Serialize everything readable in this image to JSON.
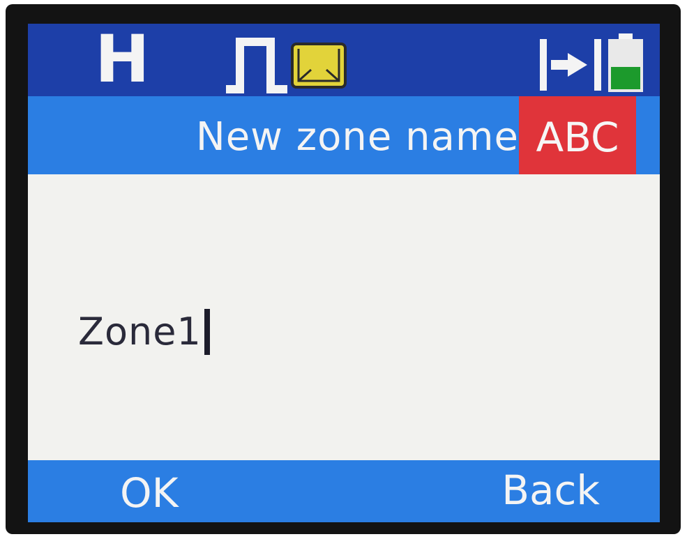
{
  "status_bar": {
    "channel_mode_label": "H",
    "icons": [
      "signal-pulse-icon",
      "message-envelope-icon",
      "transmit-icon",
      "battery-icon"
    ],
    "battery_level": 0.45,
    "colors": {
      "background": "#1d3fa8",
      "envelope": "#e2d33a",
      "battery_fill": "#1c9a2c"
    }
  },
  "header": {
    "title": "New zone name",
    "input_mode": "ABC",
    "colors": {
      "background": "#2b7ee3",
      "input_mode_background": "#e0343a"
    }
  },
  "content": {
    "zone_name_value": "Zone1"
  },
  "softkeys": {
    "left_label": "OK",
    "right_label": "Back"
  }
}
